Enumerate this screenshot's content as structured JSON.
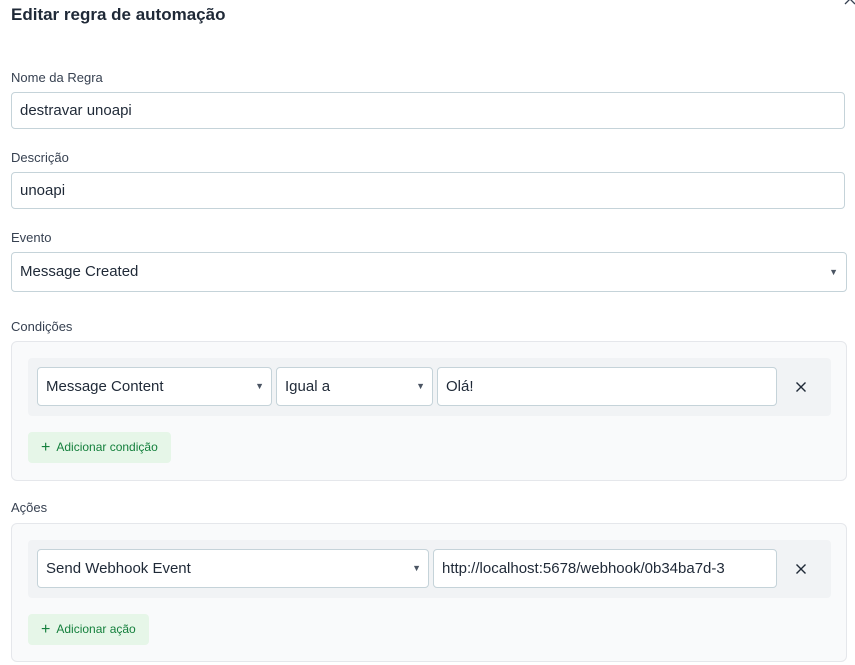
{
  "modal": {
    "title": "Editar regra de automação",
    "close_icon": "close-icon"
  },
  "form": {
    "name_label": "Nome da Regra",
    "name_value": "destravar unoapi",
    "description_label": "Descrição",
    "description_value": "unoapi",
    "event_label": "Evento",
    "event_value": "Message Created",
    "caret_glyph": "▼"
  },
  "conditions": {
    "label": "Condições",
    "rows": [
      {
        "attribute": "Message Content",
        "operator": "Igual a",
        "value": "Olá!"
      }
    ],
    "add_label": "Adicionar condição",
    "plus_glyph": "+"
  },
  "actions": {
    "label": "Ações",
    "rows": [
      {
        "action": "Send Webhook Event",
        "value": "http://localhost:5678/webhook/0b34ba7d-3"
      }
    ],
    "add_label": "Adicionar ação",
    "plus_glyph": "+"
  },
  "colors": {
    "accent_green": "#15803d",
    "add_button_bg": "#e6f6e8",
    "field_border": "#c5d3d9"
  }
}
